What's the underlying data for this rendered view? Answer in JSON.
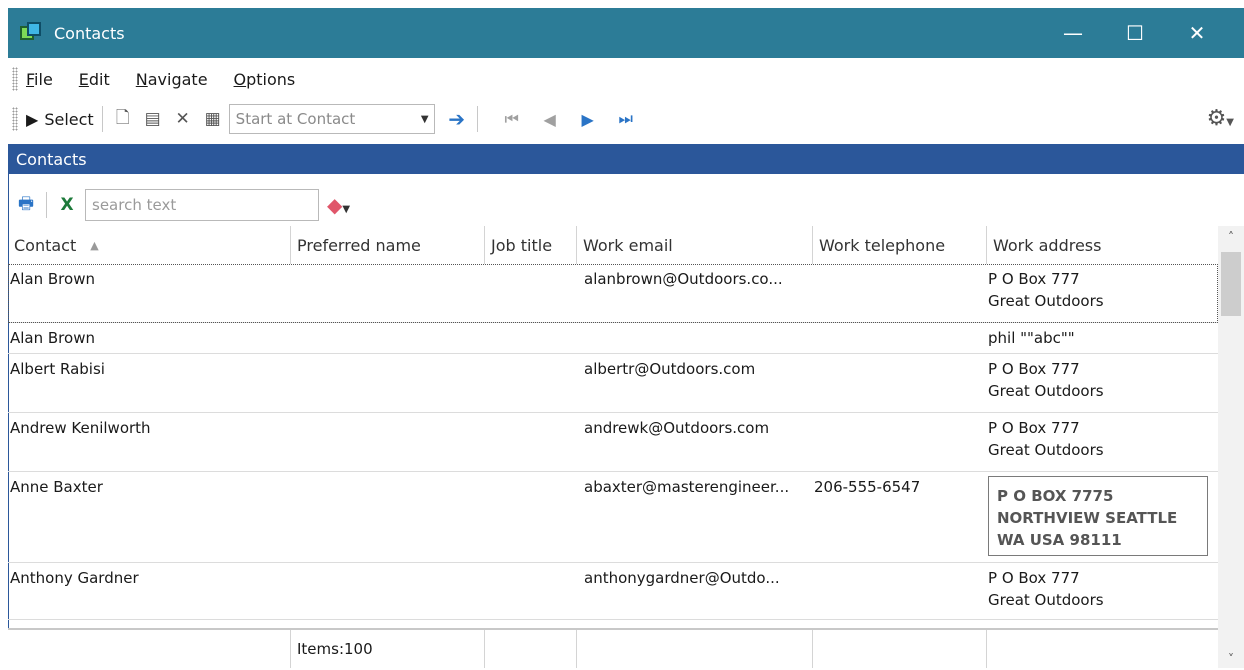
{
  "window": {
    "title": "Contacts",
    "minimize": "—",
    "maximize": "☐",
    "close": "✕"
  },
  "menu": [
    {
      "label": "File",
      "u": "F",
      "rest": "ile"
    },
    {
      "label": "Edit",
      "u": "E",
      "rest": "dit"
    },
    {
      "label": "Navigate",
      "u": "N",
      "rest": "avigate"
    },
    {
      "label": "Options",
      "u": "O",
      "rest": "ptions"
    }
  ],
  "toolbar": {
    "select_label": "Select",
    "start_placeholder": "Start at Contact"
  },
  "section": {
    "title": "Contacts"
  },
  "filter": {
    "search_placeholder": "search text"
  },
  "columns": [
    "Contact",
    "Preferred name",
    "Job title",
    "Work email",
    "Work telephone",
    "Work address"
  ],
  "rows": [
    {
      "contact": "Alan Brown",
      "preferred": "",
      "job": "",
      "email": "alanbrown@Outdoors.co...",
      "phone": "",
      "address": [
        "P O Box 777",
        "Great Outdoors"
      ]
    },
    {
      "contact": "Alan Brown",
      "preferred": "",
      "job": "",
      "email": "",
      "phone": "",
      "address": [
        "phil \"\"abc\"\""
      ]
    },
    {
      "contact": "Albert Rabisi",
      "preferred": "",
      "job": "",
      "email": "albertr@Outdoors.com",
      "phone": "",
      "address": [
        "P O Box 777",
        "Great Outdoors"
      ]
    },
    {
      "contact": "Andrew Kenilworth",
      "preferred": "",
      "job": "",
      "email": "andrewk@Outdoors.com",
      "phone": "",
      "address": [
        "P O Box 777",
        "Great Outdoors"
      ]
    },
    {
      "contact": "Anne Baxter",
      "preferred": "",
      "job": "",
      "email": "abaxter@masterengineer...",
      "phone": "206-555-6547",
      "address": [
        "P O BOX 7775",
        "NORTHVIEW SEATTLE",
        "WA USA 98111"
      ]
    },
    {
      "contact": "Anthony Gardner",
      "preferred": "",
      "job": "",
      "email": "anthonygardner@Outdo...",
      "phone": "",
      "address": [
        "P O Box 777",
        "Great Outdoors"
      ]
    }
  ],
  "footer": {
    "items": "Items:100"
  }
}
